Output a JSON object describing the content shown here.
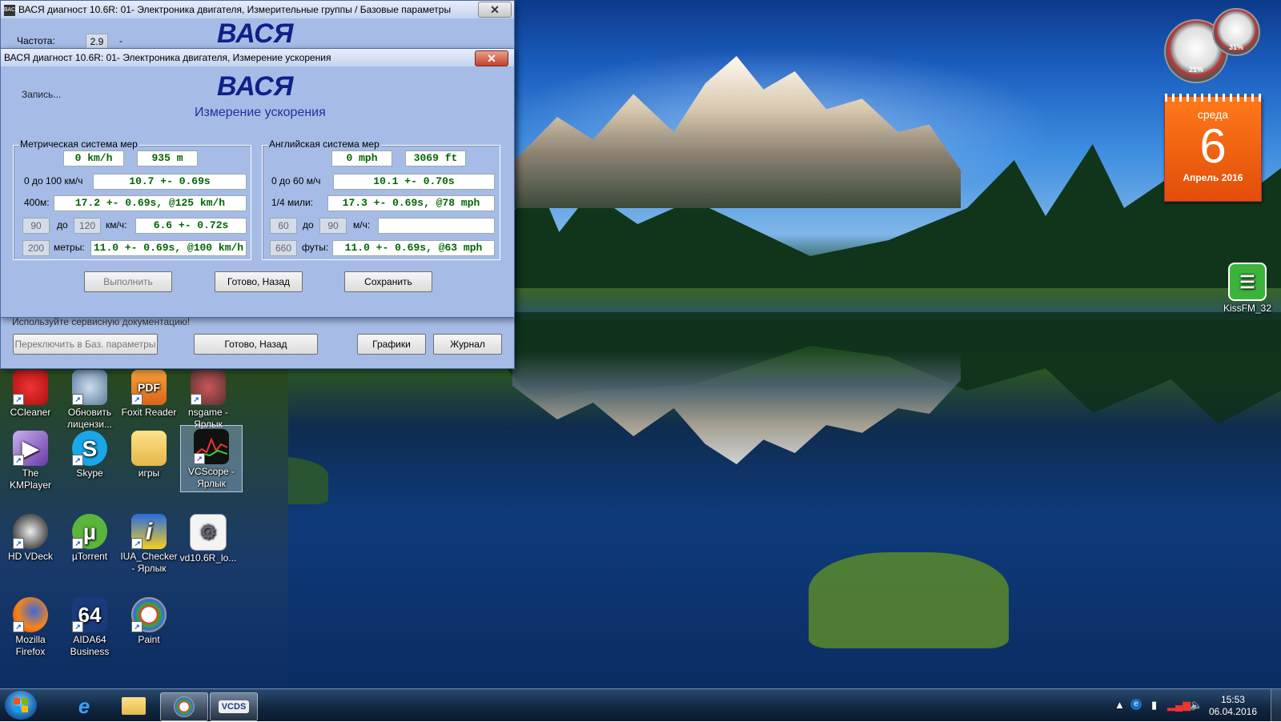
{
  "desktop_icons": [
    {
      "label": "CCleaner",
      "icon": "ccleaner-icon"
    },
    {
      "label": "Обновить лицензи...",
      "icon": "update-license-icon"
    },
    {
      "label": "Foxit Reader",
      "icon": "foxit-reader-icon"
    },
    {
      "label": "nsgame - Ярлык",
      "icon": "nsgame-icon"
    },
    {
      "label": "The KMPlayer",
      "icon": "kmplayer-icon"
    },
    {
      "label": "Skype",
      "icon": "skype-icon"
    },
    {
      "label": "игры",
      "icon": "folder-icon"
    },
    {
      "label": "VCScope - Ярлык",
      "icon": "vcscope-icon"
    },
    {
      "label": "HD VDeck",
      "icon": "hd-vdeck-icon"
    },
    {
      "label": "µTorrent",
      "icon": "utorrent-icon"
    },
    {
      "label": "IUA_Checker - Ярлык",
      "icon": "iua-checker-icon"
    },
    {
      "label": "vd10.6R_lo...",
      "icon": "settings-file-icon"
    },
    {
      "label": "Mozilla Firefox",
      "icon": "firefox-icon"
    },
    {
      "label": "AIDA64 Business",
      "icon": "aida64-icon"
    },
    {
      "label": "Paint",
      "icon": "paint-icon"
    },
    {
      "label": "KissFM_32",
      "icon": "kissfm-icon"
    }
  ],
  "gadgets": {
    "cpu_gauge_pct": "21%",
    "ram_gauge_pct": "31%",
    "calendar": {
      "weekday": "среда",
      "day": "6",
      "month_year": "Апрель 2016"
    }
  },
  "back_window": {
    "title": "ВАСЯ диагност 10.6R: 01- Электроника двигателя,  Измерительные группы / Базовые параметры",
    "logo": "ВАСЯ",
    "freq_label": "Частота:",
    "freq_value": "2.9",
    "freq_dash": "-",
    "service_doc_text": "Используйте сервисную документацию!",
    "switch_button": "Переключить в Баз. параметры",
    "done_button": "Готово, Назад",
    "graphs_button": "Графики",
    "log_button": "Журнал"
  },
  "front_window": {
    "title": "ВАСЯ диагност 10.6R: 01- Электроника двигателя,  Измерение ускорения",
    "logo": "ВАСЯ",
    "subtitle": "Измерение ускорения",
    "record_label": "Запись...",
    "metric": {
      "title": "Метрическая система мер",
      "speed": "0 km/h",
      "distance": "935 m",
      "row1_label": "0 до 100 км/ч",
      "row1_value": "10.7 +- 0.69s",
      "row2_label": "400м:",
      "row2_value": "17.2 +- 0.69s, @125 km/h",
      "row3_from": "90",
      "row3_to_label": "до",
      "row3_to": "120",
      "row3_unit": "км/ч:",
      "row3_value": "6.6 +- 0.72s",
      "row4_dist": "200",
      "row4_unit": "метры:",
      "row4_value": "11.0 +- 0.69s, @100 km/h"
    },
    "imperial": {
      "title": "Английская система мер",
      "speed": "0 mph",
      "distance": "3069 ft",
      "row1_label": "0 до 60 м/ч",
      "row1_value": "10.1 +- 0.70s",
      "row2_label": "1/4 мили:",
      "row2_value": "17.3 +- 0.69s, @78 mph",
      "row3_from": "60",
      "row3_to_label": "до",
      "row3_to": "90",
      "row3_unit": "м/ч:",
      "row3_value": "",
      "row4_dist": "660",
      "row4_unit": "футы:",
      "row4_value": "11.0 +- 0.69s, @63 mph"
    },
    "run_button": "Выполнить",
    "done_button": "Готово, Назад",
    "save_button": "Сохранить"
  },
  "taskbar": {
    "items": [
      {
        "name": "start-button",
        "icon": "windows-logo-icon"
      },
      {
        "name": "internet-explorer",
        "icon": "ie-icon"
      },
      {
        "name": "explorer",
        "icon": "folder-icon"
      },
      {
        "name": "paint",
        "icon": "paint-icon"
      },
      {
        "name": "vcds",
        "icon": "vcds-icon",
        "label": "VCDS"
      }
    ],
    "clock_time": "15:53",
    "clock_date": "06.04.2016"
  }
}
